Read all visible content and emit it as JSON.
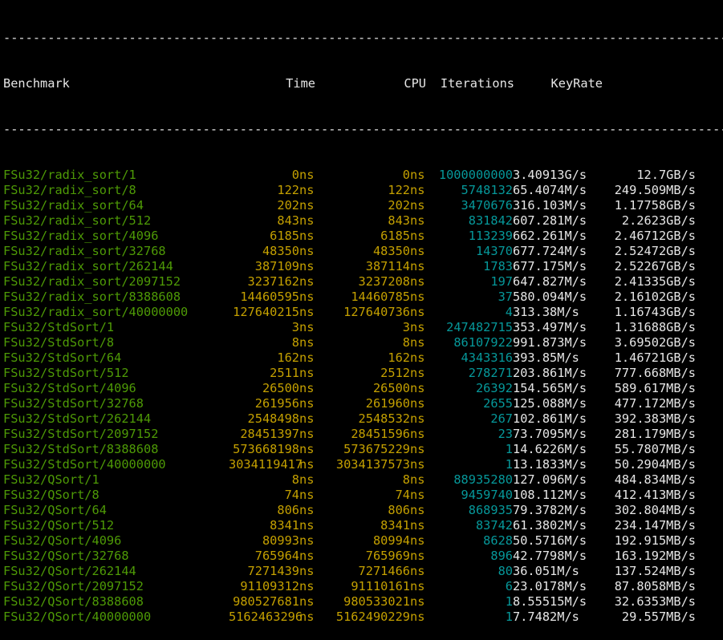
{
  "separator": "------------------------------------------------------------------------------------------------------",
  "header": {
    "benchmark": "Benchmark",
    "time": "Time",
    "cpu": "CPU",
    "iterations": "Iterations",
    "keyrate": "KeyRate"
  },
  "colors": {
    "background": "#000000",
    "name": "#4e9a06",
    "time": "#c4a000",
    "iterations": "#06989a",
    "text": "#e6e6e6"
  },
  "rows": [
    {
      "name": "FSu32/radix_sort/1",
      "time": "0",
      "time_unit": "ns",
      "cpu": "0",
      "cpu_unit": "ns",
      "iterations": "1000000000",
      "rate": "3.40913G/s",
      "bytes": "12.7GB/s"
    },
    {
      "name": "FSu32/radix_sort/8",
      "time": "122",
      "time_unit": "ns",
      "cpu": "122",
      "cpu_unit": "ns",
      "iterations": "5748132",
      "rate": "65.4074M/s",
      "bytes": "249.509MB/s"
    },
    {
      "name": "FSu32/radix_sort/64",
      "time": "202",
      "time_unit": "ns",
      "cpu": "202",
      "cpu_unit": "ns",
      "iterations": "3470676",
      "rate": "316.103M/s",
      "bytes": "1.17758GB/s"
    },
    {
      "name": "FSu32/radix_sort/512",
      "time": "843",
      "time_unit": "ns",
      "cpu": "843",
      "cpu_unit": "ns",
      "iterations": "831842",
      "rate": "607.281M/s",
      "bytes": "2.2623GB/s"
    },
    {
      "name": "FSu32/radix_sort/4096",
      "time": "6185",
      "time_unit": "ns",
      "cpu": "6185",
      "cpu_unit": "ns",
      "iterations": "113239",
      "rate": "662.261M/s",
      "bytes": "2.46712GB/s"
    },
    {
      "name": "FSu32/radix_sort/32768",
      "time": "48350",
      "time_unit": "ns",
      "cpu": "48350",
      "cpu_unit": "ns",
      "iterations": "14370",
      "rate": "677.724M/s",
      "bytes": "2.52472GB/s"
    },
    {
      "name": "FSu32/radix_sort/262144",
      "time": "387109",
      "time_unit": "ns",
      "cpu": "387114",
      "cpu_unit": "ns",
      "iterations": "1783",
      "rate": "677.175M/s",
      "bytes": "2.52267GB/s"
    },
    {
      "name": "FSu32/radix_sort/2097152",
      "time": "3237162",
      "time_unit": "ns",
      "cpu": "3237208",
      "cpu_unit": "ns",
      "iterations": "197",
      "rate": "647.827M/s",
      "bytes": "2.41335GB/s"
    },
    {
      "name": "FSu32/radix_sort/8388608",
      "time": "14460595",
      "time_unit": "ns",
      "cpu": "14460785",
      "cpu_unit": "ns",
      "iterations": "37",
      "rate": "580.094M/s",
      "bytes": "2.16102GB/s"
    },
    {
      "name": "FSu32/radix_sort/40000000",
      "time": "127640215",
      "time_unit": "ns",
      "cpu": "127640736",
      "cpu_unit": "ns",
      "iterations": "4",
      "rate": "313.38M/s",
      "bytes": "1.16743GB/s"
    },
    {
      "name": "FSu32/StdSort/1",
      "time": "3",
      "time_unit": "ns",
      "cpu": "3",
      "cpu_unit": "ns",
      "iterations": "247482715",
      "rate": "353.497M/s",
      "bytes": "1.31688GB/s"
    },
    {
      "name": "FSu32/StdSort/8",
      "time": "8",
      "time_unit": "ns",
      "cpu": "8",
      "cpu_unit": "ns",
      "iterations": "86107922",
      "rate": "991.873M/s",
      "bytes": "3.69502GB/s"
    },
    {
      "name": "FSu32/StdSort/64",
      "time": "162",
      "time_unit": "ns",
      "cpu": "162",
      "cpu_unit": "ns",
      "iterations": "4343316",
      "rate": "393.85M/s",
      "bytes": "1.46721GB/s"
    },
    {
      "name": "FSu32/StdSort/512",
      "time": "2511",
      "time_unit": "ns",
      "cpu": "2512",
      "cpu_unit": "ns",
      "iterations": "278271",
      "rate": "203.861M/s",
      "bytes": "777.668MB/s"
    },
    {
      "name": "FSu32/StdSort/4096",
      "time": "26500",
      "time_unit": "ns",
      "cpu": "26500",
      "cpu_unit": "ns",
      "iterations": "26392",
      "rate": "154.565M/s",
      "bytes": "589.617MB/s"
    },
    {
      "name": "FSu32/StdSort/32768",
      "time": "261956",
      "time_unit": "ns",
      "cpu": "261960",
      "cpu_unit": "ns",
      "iterations": "2655",
      "rate": "125.088M/s",
      "bytes": "477.172MB/s"
    },
    {
      "name": "FSu32/StdSort/262144",
      "time": "2548498",
      "time_unit": "ns",
      "cpu": "2548532",
      "cpu_unit": "ns",
      "iterations": "267",
      "rate": "102.861M/s",
      "bytes": "392.383MB/s"
    },
    {
      "name": "FSu32/StdSort/2097152",
      "time": "28451397",
      "time_unit": "ns",
      "cpu": "28451596",
      "cpu_unit": "ns",
      "iterations": "23",
      "rate": "73.7095M/s",
      "bytes": "281.179MB/s"
    },
    {
      "name": "FSu32/StdSort/8388608",
      "time": "573668198",
      "time_unit": "ns",
      "cpu": "573675229",
      "cpu_unit": "ns",
      "iterations": "1",
      "rate": "14.6226M/s",
      "bytes": "55.7807MB/s"
    },
    {
      "name": "FSu32/StdSort/40000000",
      "time": "3034119417",
      "time_unit": "ns",
      "cpu": "3034137573",
      "cpu_unit": "ns",
      "iterations": "1",
      "rate": "13.1833M/s",
      "bytes": "50.2904MB/s"
    },
    {
      "name": "FSu32/QSort/1",
      "time": "8",
      "time_unit": "ns",
      "cpu": "8",
      "cpu_unit": "ns",
      "iterations": "88935280",
      "rate": "127.096M/s",
      "bytes": "484.834MB/s"
    },
    {
      "name": "FSu32/QSort/8",
      "time": "74",
      "time_unit": "ns",
      "cpu": "74",
      "cpu_unit": "ns",
      "iterations": "9459740",
      "rate": "108.112M/s",
      "bytes": "412.413MB/s"
    },
    {
      "name": "FSu32/QSort/64",
      "time": "806",
      "time_unit": "ns",
      "cpu": "806",
      "cpu_unit": "ns",
      "iterations": "868935",
      "rate": "79.3782M/s",
      "bytes": "302.804MB/s"
    },
    {
      "name": "FSu32/QSort/512",
      "time": "8341",
      "time_unit": "ns",
      "cpu": "8341",
      "cpu_unit": "ns",
      "iterations": "83742",
      "rate": "61.3802M/s",
      "bytes": "234.147MB/s"
    },
    {
      "name": "FSu32/QSort/4096",
      "time": "80993",
      "time_unit": "ns",
      "cpu": "80994",
      "cpu_unit": "ns",
      "iterations": "8628",
      "rate": "50.5716M/s",
      "bytes": "192.915MB/s"
    },
    {
      "name": "FSu32/QSort/32768",
      "time": "765964",
      "time_unit": "ns",
      "cpu": "765969",
      "cpu_unit": "ns",
      "iterations": "896",
      "rate": "42.7798M/s",
      "bytes": "163.192MB/s"
    },
    {
      "name": "FSu32/QSort/262144",
      "time": "7271439",
      "time_unit": "ns",
      "cpu": "7271466",
      "cpu_unit": "ns",
      "iterations": "80",
      "rate": "36.051M/s",
      "bytes": "137.524MB/s"
    },
    {
      "name": "FSu32/QSort/2097152",
      "time": "91109312",
      "time_unit": "ns",
      "cpu": "91110161",
      "cpu_unit": "ns",
      "iterations": "6",
      "rate": "23.0178M/s",
      "bytes": "87.8058MB/s"
    },
    {
      "name": "FSu32/QSort/8388608",
      "time": "980527681",
      "time_unit": "ns",
      "cpu": "980533021",
      "cpu_unit": "ns",
      "iterations": "1",
      "rate": "8.55515M/s",
      "bytes": "32.6353MB/s"
    },
    {
      "name": "FSu32/QSort/40000000",
      "time": "5162463296",
      "time_unit": "ns",
      "cpu": "5162490229",
      "cpu_unit": "ns",
      "iterations": "1",
      "rate": "7.7482M/s",
      "bytes": "29.557MB/s"
    }
  ]
}
